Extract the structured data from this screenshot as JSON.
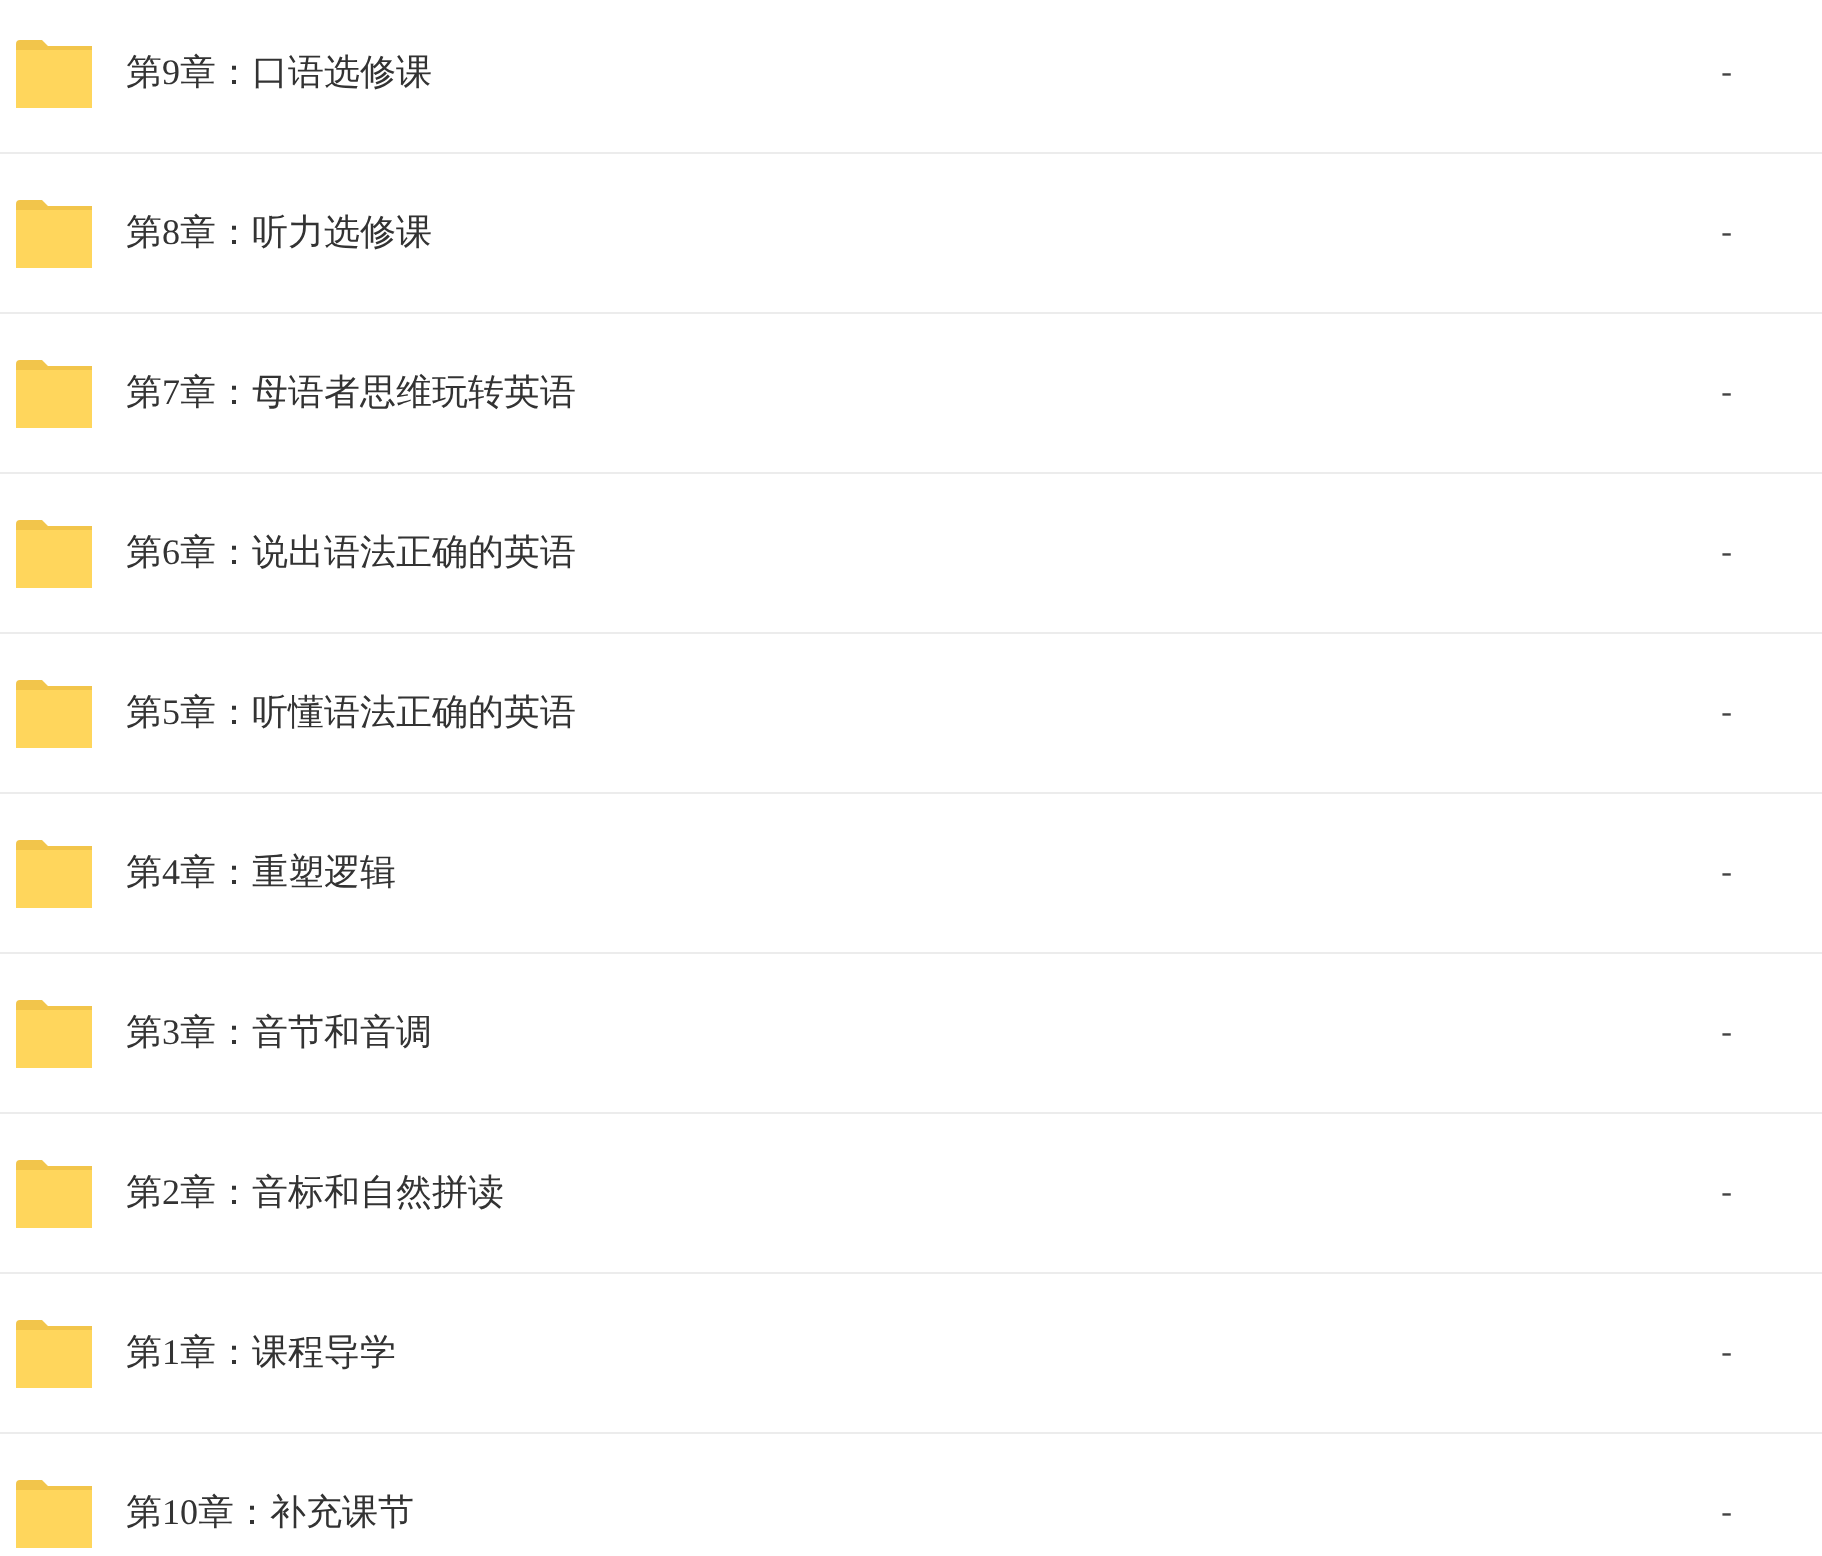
{
  "files": [
    {
      "name": "第9章：口语选修课",
      "size": "-"
    },
    {
      "name": "第8章：听力选修课",
      "size": "-"
    },
    {
      "name": "第7章：母语者思维玩转英语",
      "size": "-"
    },
    {
      "name": "第6章：说出语法正确的英语",
      "size": "-"
    },
    {
      "name": "第5章：听懂语法正确的英语",
      "size": "-"
    },
    {
      "name": "第4章：重塑逻辑",
      "size": "-"
    },
    {
      "name": "第3章：音节和音调",
      "size": "-"
    },
    {
      "name": "第2章：音标和自然拼读",
      "size": "-"
    },
    {
      "name": "第1章：课程导学",
      "size": "-"
    },
    {
      "name": "第10章：补充课节",
      "size": "-"
    }
  ]
}
